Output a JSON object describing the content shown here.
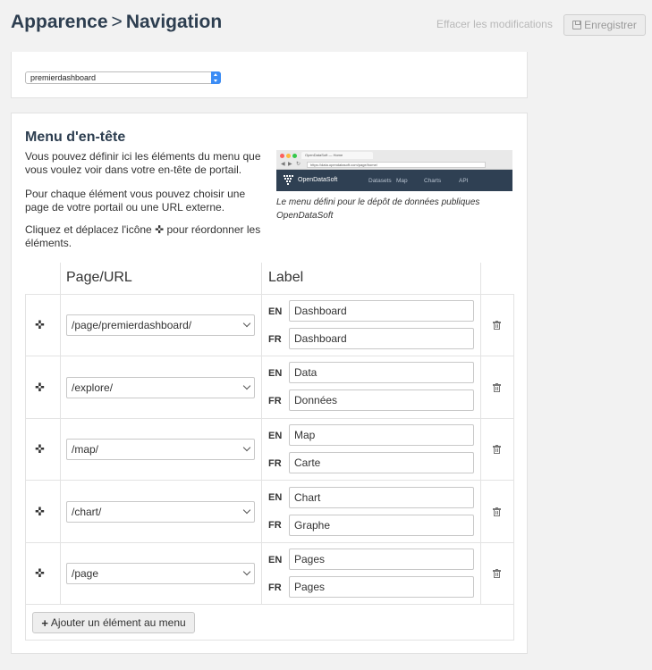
{
  "header": {
    "breadcrumb_root": "Apparence",
    "breadcrumb_separator": ">",
    "breadcrumb_current": "Navigation",
    "discard_label": "Effacer les modifications",
    "save_label": "Enregistrer"
  },
  "home_page": {
    "selected_dashboard": "premierdashboard"
  },
  "header_menu": {
    "title": "Menu d'en-tête",
    "intro": "Vous pouvez définir ici les éléments du menu que vous voulez voir dans votre en-tête de portail.",
    "choice": "Pour chaque élément vous pouvez choisir une page de votre portail ou une URL externe.",
    "drag_prefix": "Cliquez et déplacez l'icône",
    "drag_suffix": "pour réordonner les éléments.",
    "preview": {
      "tab_title": "OpenDataSoft — Home",
      "url": "https://data.opendatasoft.com/page/home/",
      "brand": "OpenDataSoft",
      "nav": [
        "Datasets",
        "Map",
        "Charts",
        "API"
      ]
    },
    "caption": "Le menu défini pour le dépôt de données publiques OpenDataSoft",
    "columns": {
      "page": "Page/URL",
      "label": "Label"
    },
    "lang_en": "EN",
    "lang_fr": "FR",
    "items": [
      {
        "page": "/page/premierdashboard/",
        "label_en": "Dashboard",
        "label_fr": "Dashboard"
      },
      {
        "page": "/explore/",
        "label_en": "Data",
        "label_fr": "Données"
      },
      {
        "page": "/map/",
        "label_en": "Map",
        "label_fr": "Carte"
      },
      {
        "page": "/chart/",
        "label_en": "Chart",
        "label_fr": "Graphe"
      },
      {
        "page": "/page",
        "label_en": "Pages",
        "label_fr": "Pages"
      }
    ],
    "add_label": "Ajouter un élément au menu"
  },
  "icons": {
    "move": "move-arrows-icon",
    "delete": "trash-icon",
    "save": "floppy-disk-icon",
    "add": "plus-icon"
  }
}
